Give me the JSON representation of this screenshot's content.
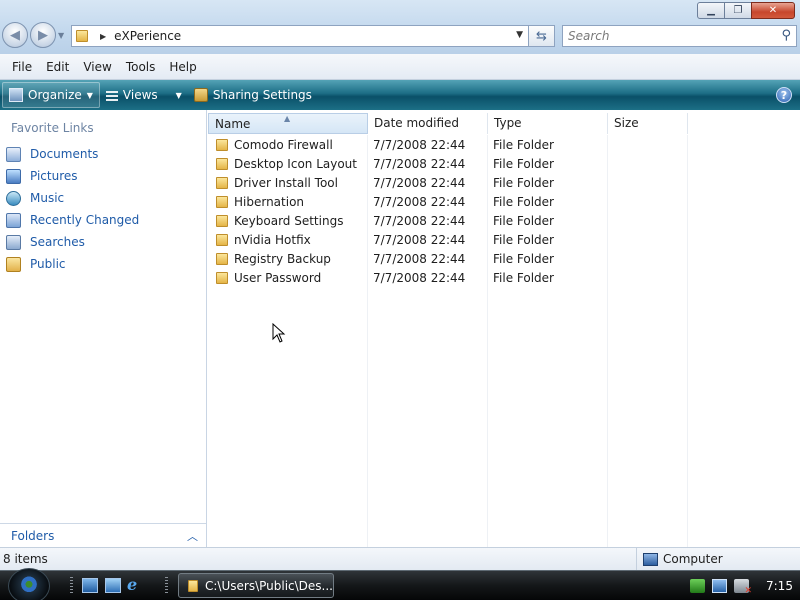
{
  "window": {
    "address": "eXPerience",
    "search_placeholder": "Search",
    "controls": {
      "minimize": "▁",
      "maximize": "❐",
      "close": "✕"
    }
  },
  "menu": {
    "items": [
      {
        "label": "File"
      },
      {
        "label": "Edit"
      },
      {
        "label": "View"
      },
      {
        "label": "Tools"
      },
      {
        "label": "Help"
      }
    ]
  },
  "toolbar": {
    "organize": "Organize",
    "views": "Views",
    "sharing": "Sharing Settings",
    "help": "?"
  },
  "navpane": {
    "title": "Favorite Links",
    "items": [
      {
        "label": "Documents",
        "icon": "documents-icon"
      },
      {
        "label": "Pictures",
        "icon": "pictures-icon"
      },
      {
        "label": "Music",
        "icon": "music-icon"
      },
      {
        "label": "Recently Changed",
        "icon": "recently-changed-icon"
      },
      {
        "label": "Searches",
        "icon": "searches-icon"
      },
      {
        "label": "Public",
        "icon": "public-folder-icon"
      }
    ],
    "folders_label": "Folders"
  },
  "filelist": {
    "columns": [
      "Name",
      "Date modified",
      "Type",
      "Size"
    ],
    "rows": [
      {
        "name": "Comodo Firewall",
        "date": "7/7/2008 22:44",
        "type": "File Folder"
      },
      {
        "name": "Desktop Icon Layout",
        "date": "7/7/2008 22:44",
        "type": "File Folder"
      },
      {
        "name": "Driver Install Tool",
        "date": "7/7/2008 22:44",
        "type": "File Folder"
      },
      {
        "name": "Hibernation",
        "date": "7/7/2008 22:44",
        "type": "File Folder"
      },
      {
        "name": "Keyboard Settings",
        "date": "7/7/2008 22:44",
        "type": "File Folder"
      },
      {
        "name": "nVidia Hotfix",
        "date": "7/7/2008 22:44",
        "type": "File Folder"
      },
      {
        "name": "Registry Backup",
        "date": "7/7/2008 22:44",
        "type": "File Folder"
      },
      {
        "name": "User Password",
        "date": "7/7/2008 22:44",
        "type": "File Folder"
      }
    ]
  },
  "statusbar": {
    "count": "8 items",
    "zone": "Computer"
  },
  "taskbar": {
    "task_label": "C:\\Users\\Public\\Des...",
    "clock": "7:15"
  },
  "colors": {
    "toolbar_accent": "#0a5068",
    "link_blue": "#1f5ba8",
    "folder_yellow": "#e4b547"
  }
}
